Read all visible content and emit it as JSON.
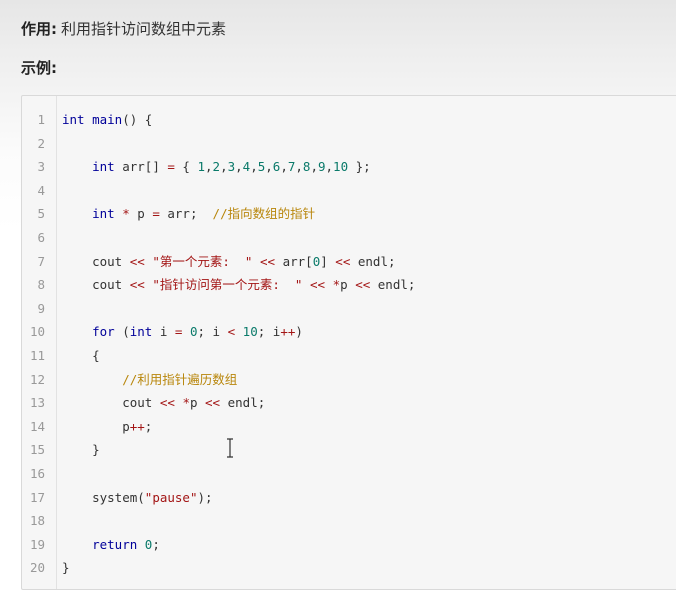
{
  "purpose": {
    "label": "作用:",
    "text": "利用指针访问数组中元素"
  },
  "example": {
    "label": "示例:"
  },
  "code_lines": [
    {
      "n": "1",
      "t": [
        [
          "kw",
          "int"
        ],
        [
          "t",
          " "
        ],
        [
          "fn",
          "main"
        ],
        [
          "t",
          "() {"
        ]
      ]
    },
    {
      "n": "2",
      "t": []
    },
    {
      "n": "3",
      "t": [
        [
          "t",
          "    "
        ],
        [
          "kw",
          "int"
        ],
        [
          "t",
          " arr[] "
        ],
        [
          "op",
          "="
        ],
        [
          "t",
          " { "
        ],
        [
          "num",
          "1"
        ],
        [
          "t",
          ","
        ],
        [
          "num",
          "2"
        ],
        [
          "t",
          ","
        ],
        [
          "num",
          "3"
        ],
        [
          "t",
          ","
        ],
        [
          "num",
          "4"
        ],
        [
          "t",
          ","
        ],
        [
          "num",
          "5"
        ],
        [
          "t",
          ","
        ],
        [
          "num",
          "6"
        ],
        [
          "t",
          ","
        ],
        [
          "num",
          "7"
        ],
        [
          "t",
          ","
        ],
        [
          "num",
          "8"
        ],
        [
          "t",
          ","
        ],
        [
          "num",
          "9"
        ],
        [
          "t",
          ","
        ],
        [
          "num",
          "10"
        ],
        [
          "t",
          " };"
        ]
      ]
    },
    {
      "n": "4",
      "t": []
    },
    {
      "n": "5",
      "t": [
        [
          "t",
          "    "
        ],
        [
          "kw",
          "int"
        ],
        [
          "t",
          " "
        ],
        [
          "op",
          "*"
        ],
        [
          "t",
          " p "
        ],
        [
          "op",
          "="
        ],
        [
          "t",
          " arr;  "
        ],
        [
          "cmt",
          "//指向数组的指针"
        ]
      ]
    },
    {
      "n": "6",
      "t": []
    },
    {
      "n": "7",
      "t": [
        [
          "t",
          "    cout "
        ],
        [
          "op",
          "<<"
        ],
        [
          "t",
          " "
        ],
        [
          "str",
          "\"第一个元素:  \""
        ],
        [
          "t",
          " "
        ],
        [
          "op",
          "<<"
        ],
        [
          "t",
          " arr["
        ],
        [
          "num",
          "0"
        ],
        [
          "t",
          "] "
        ],
        [
          "op",
          "<<"
        ],
        [
          "t",
          " endl;"
        ]
      ]
    },
    {
      "n": "8",
      "t": [
        [
          "t",
          "    cout "
        ],
        [
          "op",
          "<<"
        ],
        [
          "t",
          " "
        ],
        [
          "str",
          "\"指针访问第一个元素:  \""
        ],
        [
          "t",
          " "
        ],
        [
          "op",
          "<<"
        ],
        [
          "t",
          " "
        ],
        [
          "op",
          "*"
        ],
        [
          "t",
          "p "
        ],
        [
          "op",
          "<<"
        ],
        [
          "t",
          " endl;"
        ]
      ]
    },
    {
      "n": "9",
      "t": []
    },
    {
      "n": "10",
      "t": [
        [
          "t",
          "    "
        ],
        [
          "kw",
          "for"
        ],
        [
          "t",
          " ("
        ],
        [
          "kw",
          "int"
        ],
        [
          "t",
          " i "
        ],
        [
          "op",
          "="
        ],
        [
          "t",
          " "
        ],
        [
          "num",
          "0"
        ],
        [
          "t",
          "; i "
        ],
        [
          "op",
          "<"
        ],
        [
          "t",
          " "
        ],
        [
          "num",
          "10"
        ],
        [
          "t",
          "; i"
        ],
        [
          "op",
          "++"
        ],
        [
          "t",
          ")"
        ]
      ]
    },
    {
      "n": "11",
      "t": [
        [
          "t",
          "    {"
        ]
      ]
    },
    {
      "n": "12",
      "t": [
        [
          "t",
          "        "
        ],
        [
          "cmt",
          "//利用指针遍历数组"
        ]
      ]
    },
    {
      "n": "13",
      "t": [
        [
          "t",
          "        cout "
        ],
        [
          "op",
          "<<"
        ],
        [
          "t",
          " "
        ],
        [
          "op",
          "*"
        ],
        [
          "t",
          "p "
        ],
        [
          "op",
          "<<"
        ],
        [
          "t",
          " endl;"
        ]
      ]
    },
    {
      "n": "14",
      "t": [
        [
          "t",
          "        p"
        ],
        [
          "op",
          "++"
        ],
        [
          "t",
          ";"
        ]
      ]
    },
    {
      "n": "15",
      "t": [
        [
          "t",
          "    }"
        ]
      ]
    },
    {
      "n": "16",
      "t": []
    },
    {
      "n": "17",
      "t": [
        [
          "t",
          "    system("
        ],
        [
          "str",
          "\"pause\""
        ],
        [
          "t",
          ");"
        ]
      ]
    },
    {
      "n": "18",
      "t": []
    },
    {
      "n": "19",
      "t": [
        [
          "t",
          "    "
        ],
        [
          "kw",
          "return"
        ],
        [
          "t",
          " "
        ],
        [
          "num",
          "0"
        ],
        [
          "t",
          ";"
        ]
      ]
    },
    {
      "n": "20",
      "t": [
        [
          "t",
          "}"
        ]
      ]
    }
  ]
}
